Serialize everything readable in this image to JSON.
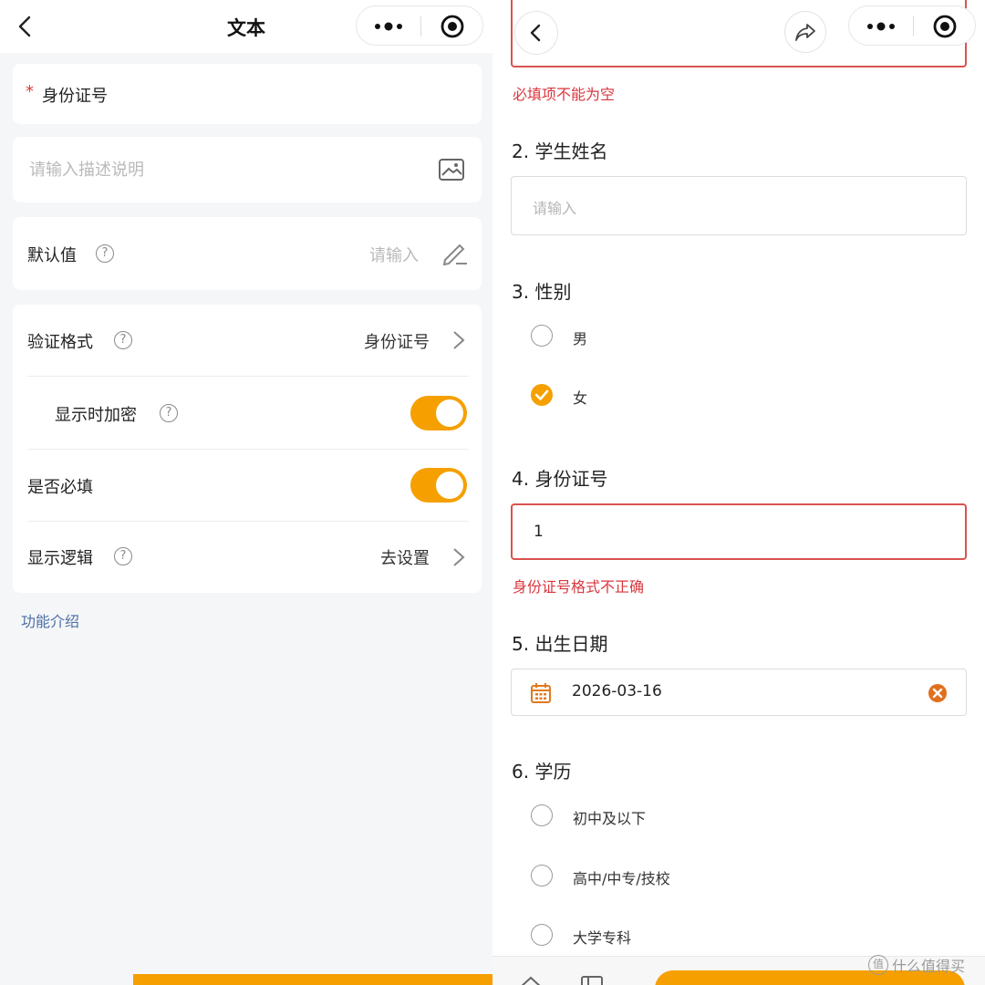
{
  "left": {
    "title": "文本",
    "field_name": "身份证号",
    "required_star": "*",
    "description_placeholder": "请输入描述说明",
    "default_value_label": "默认值",
    "default_value_placeholder": "请输入",
    "validation_label": "验证格式",
    "validation_value": "身份证号",
    "encrypt_label": "显示时加密",
    "encrypt_on": true,
    "required_label": "是否必填",
    "required_on": true,
    "logic_label": "显示逻辑",
    "logic_value": "去设置",
    "help_glyph": "?",
    "feature_link": "功能介绍"
  },
  "right": {
    "top_error": "必填项不能为空",
    "q2": {
      "title": "2. 学生姓名",
      "placeholder": "请输入"
    },
    "q3": {
      "title": "3. 性别",
      "options": [
        "男",
        "女"
      ],
      "selected": "女"
    },
    "q4": {
      "title": "4. 身份证号",
      "value": "1",
      "error": "身份证号格式不正确"
    },
    "q5": {
      "title": "5. 出生日期",
      "value": "2026-03-16"
    },
    "q6": {
      "title": "6. 学历",
      "options": [
        "初中及以下",
        "高中/中专/技校",
        "大学专科"
      ]
    }
  },
  "watermark": {
    "icon_text": "值",
    "text": "什么值得买"
  },
  "colors": {
    "accent": "#f5a000",
    "error": "#d9363e",
    "link": "#4a6fa5"
  }
}
